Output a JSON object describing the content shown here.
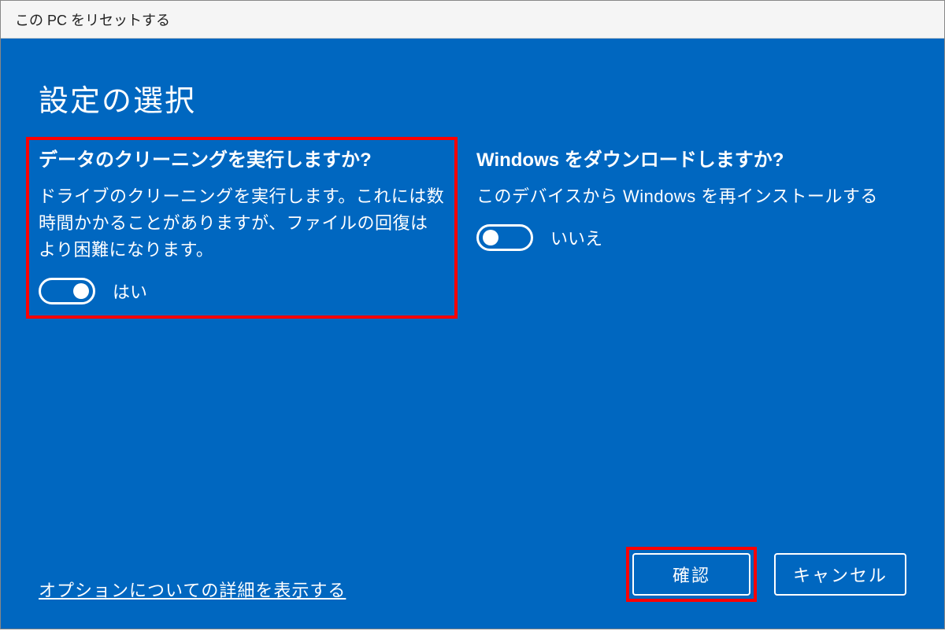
{
  "window": {
    "title": "この PC をリセットする"
  },
  "page": {
    "title": "設定の選択"
  },
  "settings": {
    "clean": {
      "title": "データのクリーニングを実行しますか?",
      "description": "ドライブのクリーニングを実行します。これには数時間かかることがありますが、ファイルの回復はより困難になります。",
      "state": "on",
      "state_label": "はい"
    },
    "download": {
      "title": "Windows をダウンロードしますか?",
      "description": "このデバイスから Windows を再インストールする",
      "state": "off",
      "state_label": "いいえ"
    }
  },
  "footer": {
    "more_options": "オプションについての詳細を表示する",
    "confirm": "確認",
    "cancel": "キャンセル"
  }
}
